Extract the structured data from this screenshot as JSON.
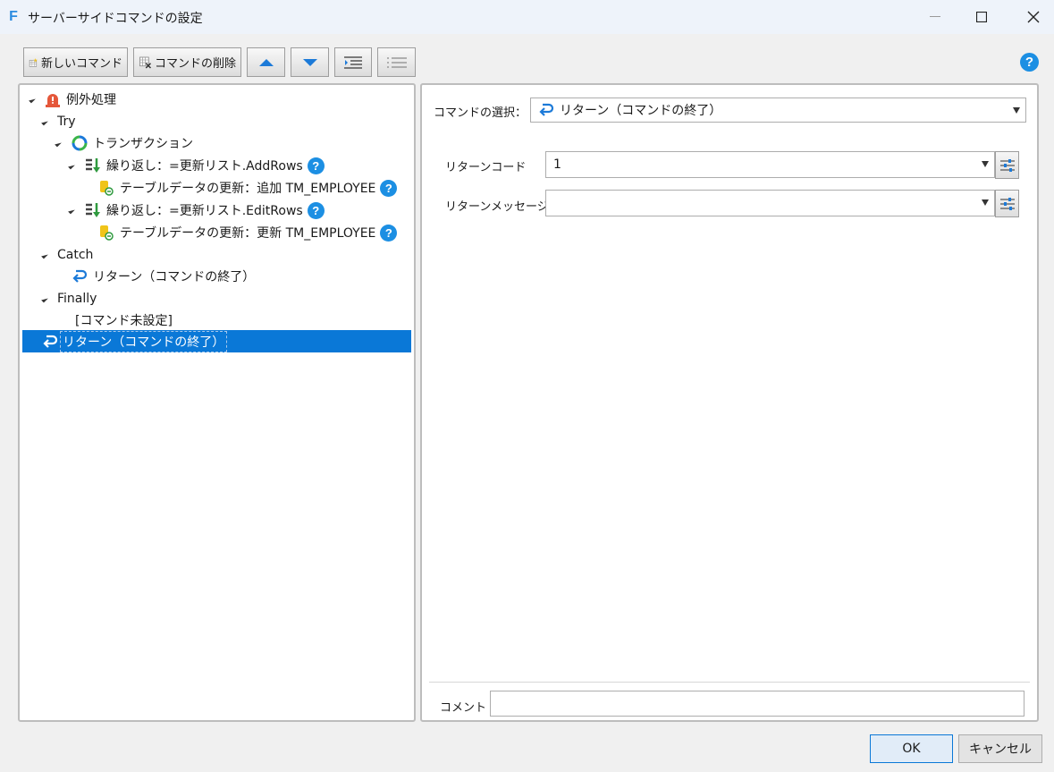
{
  "window": {
    "title": "サーバーサイドコマンドの設定",
    "app_icon_letter": "F"
  },
  "toolbar": {
    "new_command_label": "新しいコマンド",
    "delete_command_label": "コマンドの削除"
  },
  "help_glyph": "?",
  "tree": {
    "root": "例外処理",
    "try": "Try",
    "transaction": "トランザクション",
    "loop1": "繰り返し：=更新リスト.AddRows",
    "update1": "テーブルデータの更新：追加 TM_EMPLOYEE",
    "loop2": "繰り返し：=更新リスト.EditRows",
    "update2": "テーブルデータの更新：更新 TM_EMPLOYEE",
    "catch": "Catch",
    "catch_return": "リターン（コマンドの終了）",
    "finally": "Finally",
    "unset": "[コマンド未設定]",
    "selected": "リターン（コマンドの終了）"
  },
  "detail": {
    "command_select_label": "コマンドの選択：",
    "command_select_value": "リターン（コマンドの終了）",
    "return_code_label": "リターンコード",
    "return_code_value": "1",
    "return_message_label": "リターンメッセージ",
    "return_message_value": "",
    "comment_label": "コメント",
    "comment_value": ""
  },
  "buttons": {
    "ok": "OK",
    "cancel": "キャンセル"
  },
  "colors": {
    "selection": "#0a78d7",
    "help_blue": "#1c8fe3"
  }
}
